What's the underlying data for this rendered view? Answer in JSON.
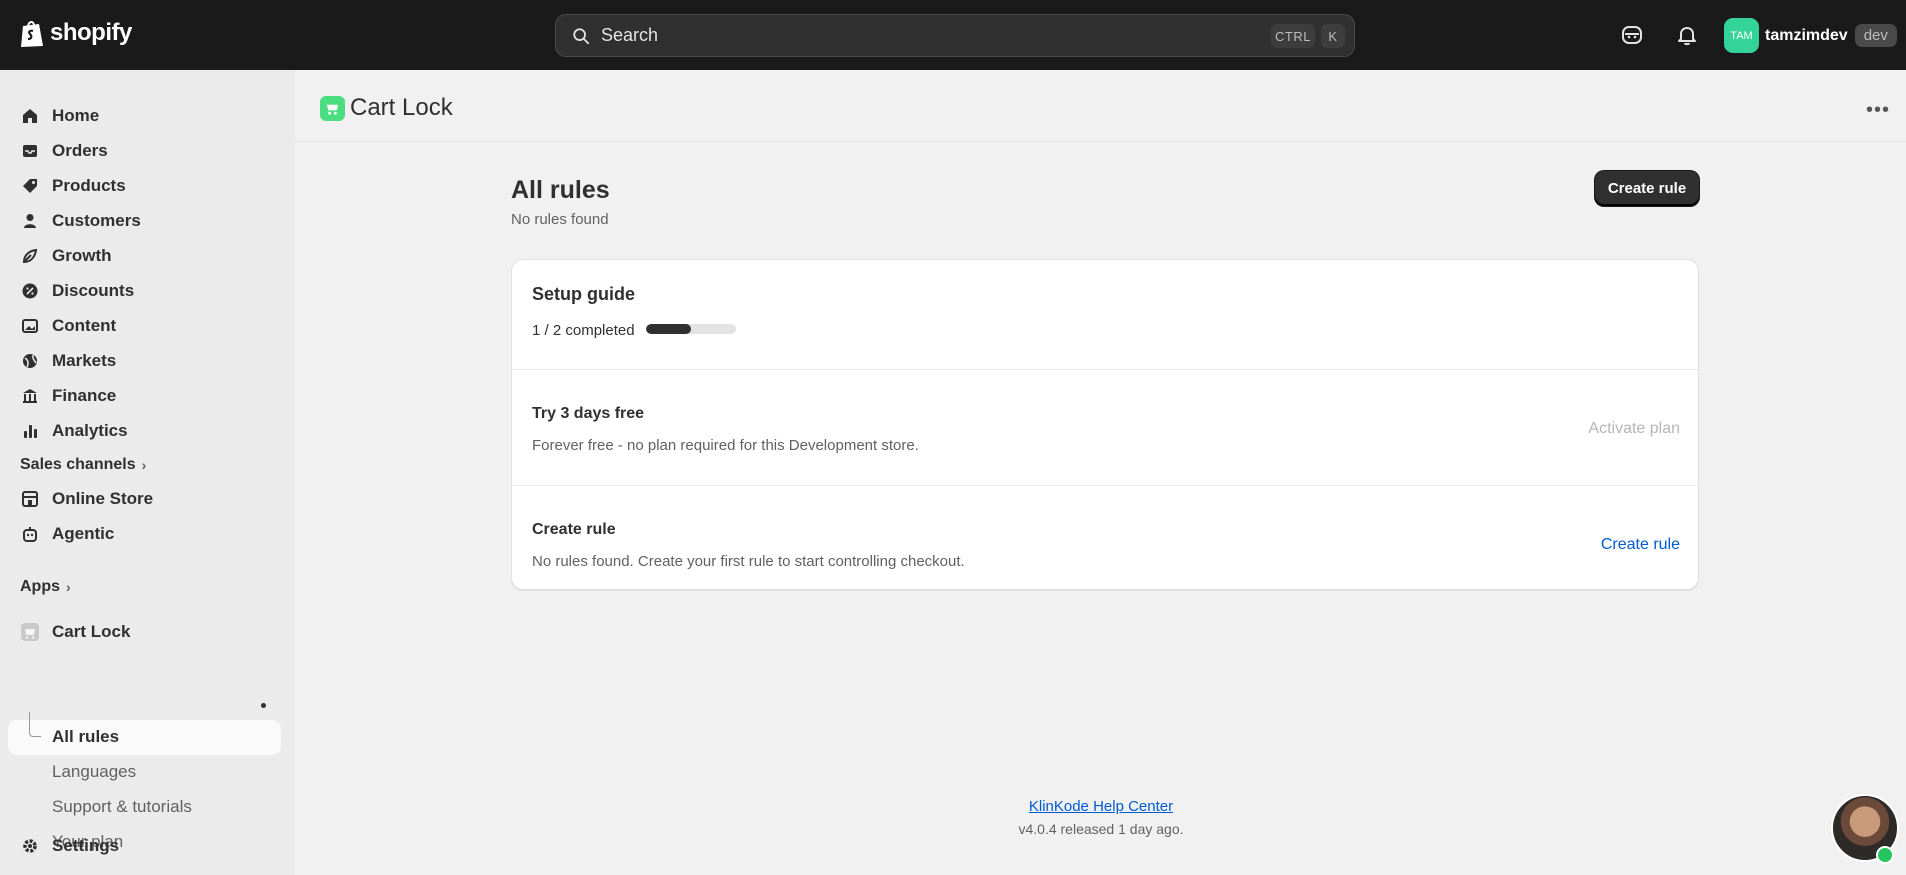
{
  "topbar": {
    "brand": "shopify",
    "search_placeholder": "Search",
    "kbd_ctrl": "CTRL",
    "kbd_k": "K",
    "user_initials": "TAM",
    "username": "tamzimdev",
    "store_badge": "dev"
  },
  "sidebar": {
    "items": [
      {
        "label": "Home",
        "icon": "home-icon"
      },
      {
        "label": "Orders",
        "icon": "inbox-icon"
      },
      {
        "label": "Products",
        "icon": "tag-icon"
      },
      {
        "label": "Customers",
        "icon": "person-icon"
      },
      {
        "label": "Growth",
        "icon": "growth-icon"
      },
      {
        "label": "Discounts",
        "icon": "discount-icon"
      },
      {
        "label": "Content",
        "icon": "image-icon"
      },
      {
        "label": "Markets",
        "icon": "globe-icon"
      },
      {
        "label": "Finance",
        "icon": "bank-icon"
      },
      {
        "label": "Analytics",
        "icon": "bar-chart-icon"
      }
    ],
    "sales_channels_label": "Sales channels",
    "channels": [
      {
        "label": "Online Store",
        "icon": "store-icon"
      },
      {
        "label": "Agentic",
        "icon": "agent-icon"
      }
    ],
    "apps_label": "Apps",
    "app_name": "Cart Lock",
    "app_subitems": [
      "All rules",
      "Languages",
      "Support & tutorials",
      "Your plan"
    ],
    "settings_label": "Settings"
  },
  "app_header": {
    "title": "Cart Lock"
  },
  "page": {
    "title": "All rules",
    "subtitle": "No rules found",
    "create_button": "Create rule"
  },
  "setup_guide": {
    "title": "Setup guide",
    "progress_text": "1 / 2 completed",
    "progress_fraction": 0.5,
    "tasks": [
      {
        "title": "Try 3 days free",
        "description": "Forever free - no plan required for this Development store.",
        "action": "Activate plan"
      },
      {
        "title": "Create rule",
        "description": "No rules found. Create your first rule to start controlling checkout.",
        "action": "Create rule"
      }
    ]
  },
  "footer": {
    "help_link": "KlinKode Help Center",
    "version": "v4.0.4 released 1 day ago."
  },
  "colors": {
    "topbar": "#1a1a1a",
    "accent_link": "#005bd3",
    "app_icon": "#4ade80",
    "avatar": "#34d399",
    "online": "#22c55e"
  }
}
